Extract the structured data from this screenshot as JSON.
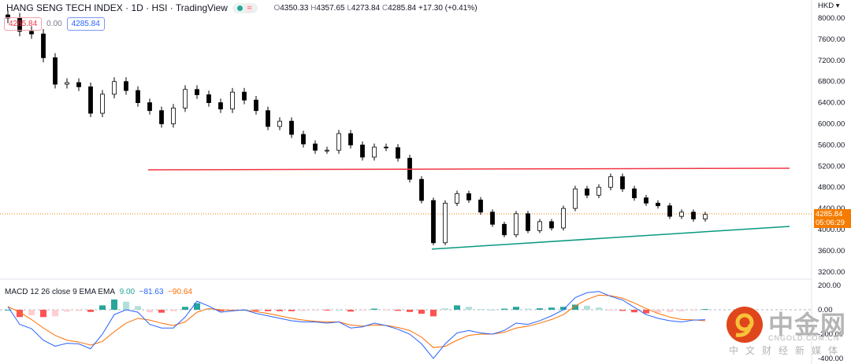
{
  "header": {
    "title": "HANG SENG TECH INDEX · 1D · HSI · TradingView",
    "open_label": "O",
    "open": "4350.33",
    "high_label": "H",
    "high": "4357.65",
    "low_label": "L",
    "low": "4273.84",
    "close_label": "C",
    "close": "4285.84",
    "change": "+17.30 (+0.41%)",
    "status_icon": "market-open-dot-icon",
    "wave_icon": "wave-icon"
  },
  "value_boxes": {
    "left": "4285.84",
    "mid": "0.00",
    "right": "4285.84"
  },
  "price_axis": {
    "currency": "HKD",
    "current_price": "4285.84",
    "countdown": "05:06:29",
    "ticks": [
      "8000.00",
      "7600.00",
      "7200.00",
      "6800.00",
      "6400.00",
      "6000.00",
      "5600.00",
      "5200.00",
      "4800.00",
      "4400.00",
      "4000.00",
      "3600.00",
      "3200.00"
    ]
  },
  "macd_axis": {
    "ticks": [
      "200.00",
      "0.00",
      "-200.00",
      "-400.00"
    ]
  },
  "macd_legend": {
    "label": "MACD 12 26 close 9 EMA EMA",
    "hist": "9.00",
    "macd": "−81.63",
    "signal": "−90.64"
  },
  "watermark": {
    "brand": "中金网",
    "domain": "CNGOLD.COM.CN",
    "tagline": "中文财经新媒体"
  },
  "chart_data": [
    {
      "type": "candlestick",
      "title": "HANG SENG TECH INDEX",
      "ylim": [
        3200,
        8000
      ],
      "grid": false,
      "closes": [
        8000,
        7750,
        7700,
        7250,
        6750,
        6780,
        6700,
        6200,
        6560,
        6800,
        6630,
        6400,
        6250,
        6000,
        6300,
        6650,
        6550,
        6400,
        6280,
        6600,
        6450,
        6250,
        5950,
        6050,
        5800,
        5620,
        5500,
        5500,
        5815,
        5600,
        5370,
        5560,
        5550,
        5350,
        4950,
        4550,
        3750,
        4500,
        4680,
        4560,
        4330,
        4100,
        3900,
        4300,
        3980,
        4150,
        4030,
        4400,
        4770,
        4650,
        4800,
        5000,
        4770,
        4600,
        4500,
        4450,
        4250,
        4330,
        4200,
        4285.84
      ],
      "trendlines": [
        {
          "color": "#f23645",
          "from": [
            12,
            5130
          ],
          "to": [
            66,
            5160
          ]
        },
        {
          "color": "#089981",
          "from": [
            36,
            3630
          ],
          "to": [
            66,
            4060
          ]
        }
      ],
      "colors": {
        "up": "#ffffff",
        "down": "#000000",
        "outline": "#000000"
      }
    },
    {
      "type": "macd",
      "ylim": [
        -400,
        200
      ],
      "macd": [
        25,
        -120,
        -155,
        -250,
        -300,
        -275,
        -280,
        -320,
        -200,
        -40,
        0,
        -20,
        -120,
        -150,
        -150,
        -60,
        70,
        30,
        -20,
        -10,
        0,
        -30,
        -50,
        -70,
        -90,
        -100,
        -100,
        -110,
        -100,
        -150,
        -140,
        -110,
        -130,
        -160,
        -200,
        -280,
        -400,
        -280,
        -190,
        -170,
        -190,
        -200,
        -170,
        -110,
        -120,
        -90,
        -50,
        0,
        100,
        140,
        150,
        110,
        80,
        20,
        -40,
        -70,
        -90,
        -100,
        -85,
        -81.63
      ],
      "signal": [
        25,
        -20,
        -80,
        -150,
        -210,
        -250,
        -265,
        -290,
        -260,
        -180,
        -110,
        -70,
        -85,
        -110,
        -130,
        -100,
        -20,
        10,
        0,
        -5,
        -3,
        -15,
        -30,
        -50,
        -70,
        -85,
        -95,
        -100,
        -100,
        -125,
        -135,
        -125,
        -128,
        -145,
        -170,
        -225,
        -310,
        -300,
        -250,
        -210,
        -200,
        -200,
        -185,
        -150,
        -135,
        -110,
        -80,
        -40,
        30,
        85,
        120,
        115,
        95,
        55,
        10,
        -30,
        -60,
        -80,
        -83,
        -90.64
      ],
      "colors": {
        "macd": "#2962ff",
        "signal": "#ff6d00",
        "hist_up": "#26a69a",
        "hist_up_light": "#b2dfdb",
        "hist_down": "#ff5252",
        "hist_down_light": "#ffcdd2"
      }
    }
  ]
}
